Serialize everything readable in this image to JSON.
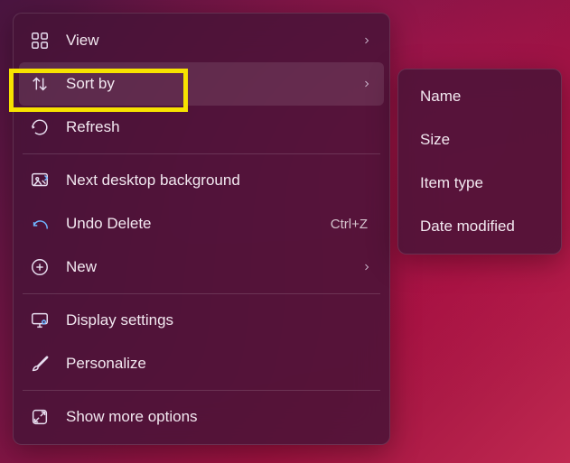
{
  "main_menu": {
    "groups": [
      [
        {
          "id": "view",
          "label": "View",
          "icon": "grid-icon",
          "has_submenu": true
        },
        {
          "id": "sort-by",
          "label": "Sort by",
          "icon": "sort-icon",
          "has_submenu": true,
          "hovered": true,
          "highlighted": true
        },
        {
          "id": "refresh",
          "label": "Refresh",
          "icon": "refresh-icon"
        }
      ],
      [
        {
          "id": "next-desktop-background",
          "label": "Next desktop background",
          "icon": "image-next-icon"
        },
        {
          "id": "undo-delete",
          "label": "Undo Delete",
          "icon": "undo-icon",
          "shortcut": "Ctrl+Z"
        },
        {
          "id": "new",
          "label": "New",
          "icon": "plus-circle-icon",
          "has_submenu": true
        }
      ],
      [
        {
          "id": "display-settings",
          "label": "Display settings",
          "icon": "display-gear-icon"
        },
        {
          "id": "personalize",
          "label": "Personalize",
          "icon": "brush-icon"
        }
      ],
      [
        {
          "id": "show-more-options",
          "label": "Show more options",
          "icon": "expand-icon"
        }
      ]
    ]
  },
  "sub_menu": {
    "items": [
      {
        "id": "name",
        "label": "Name"
      },
      {
        "id": "size",
        "label": "Size"
      },
      {
        "id": "item-type",
        "label": "Item type"
      },
      {
        "id": "date-modified",
        "label": "Date modified"
      }
    ]
  }
}
